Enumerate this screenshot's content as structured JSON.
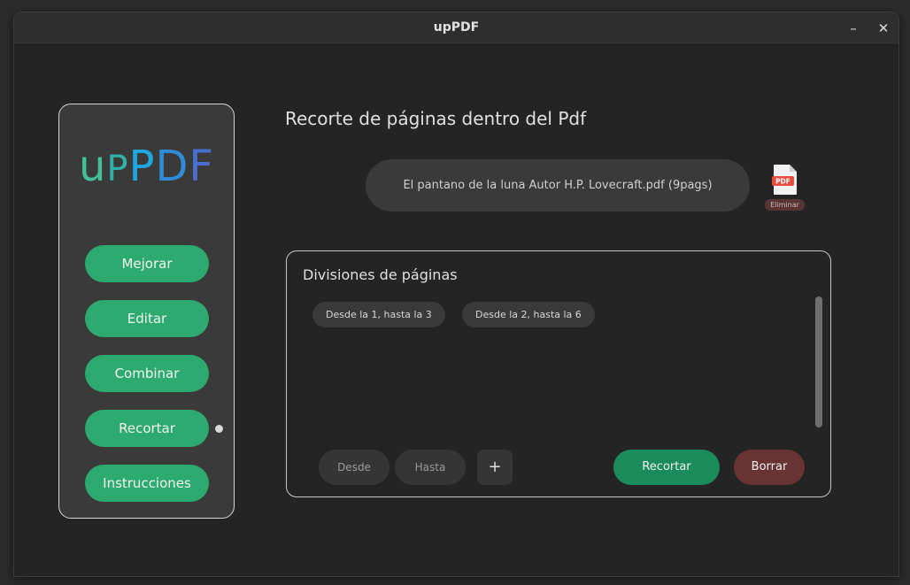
{
  "window": {
    "title": "upPDF",
    "minimize_label": "–",
    "close_label": "✕"
  },
  "sidebar": {
    "logo": {
      "u": "u",
      "p1": "P",
      "p2": "P",
      "d": "D",
      "f": "F"
    },
    "items": [
      {
        "label": "Mejorar"
      },
      {
        "label": "Editar"
      },
      {
        "label": "Combinar"
      },
      {
        "label": "Recortar",
        "active": true
      },
      {
        "label": "Instrucciones"
      }
    ]
  },
  "main": {
    "title": "Recorte de páginas dentro del Pdf",
    "file": {
      "name": "El pantano de la luna Autor H.P. Lovecraft.pdf (9pags)",
      "icon": "pdf-file-icon",
      "icon_label": "PDF",
      "delete_label": "Eliminar"
    },
    "divisions": {
      "title": "Divisiones de páginas",
      "chips": [
        {
          "label": "Desde la 1, hasta la 3"
        },
        {
          "label": "Desde la 2, hasta la 6"
        }
      ],
      "from_placeholder": "Desde",
      "to_placeholder": "Hasta",
      "add_label": "+",
      "crop_label": "Recortar",
      "clear_label": "Borrar"
    }
  },
  "colors": {
    "accent_green": "#2daa70",
    "crop_green": "#1a8b5a",
    "clear_red": "#6a3333",
    "background": "#242424"
  }
}
